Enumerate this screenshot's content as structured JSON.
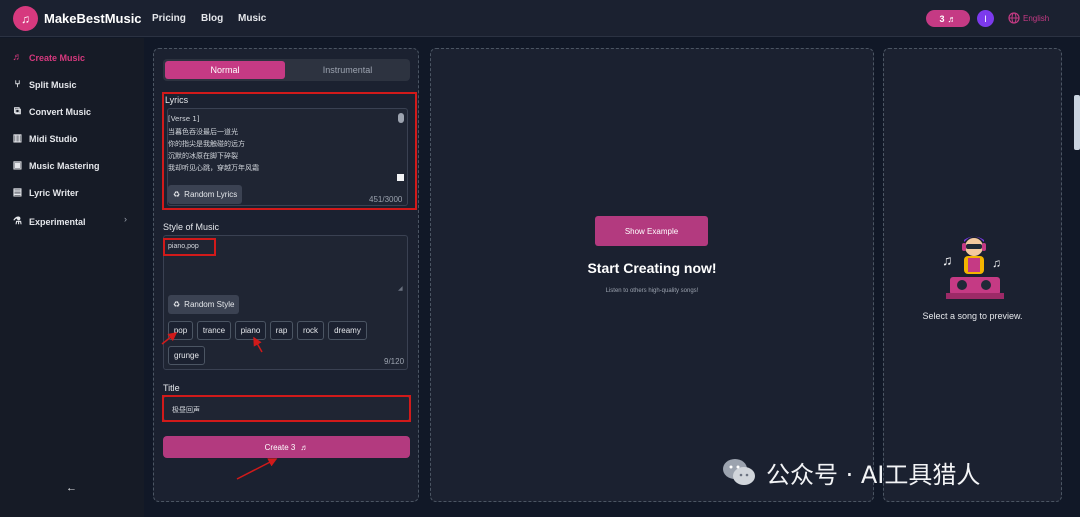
{
  "header": {
    "brand": "MakeBestMusic",
    "nav": [
      "Pricing",
      "Blog",
      "Music"
    ],
    "credits": "3",
    "avatar_initial": "I",
    "language": "English"
  },
  "sidebar": {
    "items": [
      {
        "label": "Create Music",
        "icon": "music-note-icon",
        "active": true
      },
      {
        "label": "Split Music",
        "icon": "split-icon"
      },
      {
        "label": "Convert Music",
        "icon": "convert-icon"
      },
      {
        "label": "Midi Studio",
        "icon": "midi-icon"
      },
      {
        "label": "Music Mastering",
        "icon": "mastering-icon"
      },
      {
        "label": "Lyric Writer",
        "icon": "document-icon"
      },
      {
        "label": "Experimental",
        "icon": "flask-icon"
      }
    ],
    "back": "←"
  },
  "form": {
    "mode_tabs": {
      "normal": "Normal",
      "instrumental": "Instrumental"
    },
    "lyrics_label": "Lyrics",
    "lyrics_lines": [
      "[Verse 1]",
      "当暮色吞没最后一道光",
      "你的指尖是我触碰的远方",
      "沉默的冰原在脚下碎裂",
      "我却听见心跳，穿越万年风霜"
    ],
    "random_lyrics": "Random Lyrics",
    "lyrics_count": "451/3000",
    "style_label": "Style of Music",
    "style_value": "piano,pop",
    "random_style": "Random Style",
    "style_tags": [
      "pop",
      "trance",
      "piano",
      "rap",
      "rock",
      "dreamy",
      "grunge"
    ],
    "style_count": "9/120",
    "title_label": "Title",
    "title_value": "极昼回声",
    "create_label": "Create  3"
  },
  "center": {
    "show_example": "Show Example",
    "heading": "Start Creating now!",
    "subtext": "Listen to others high-quality songs!"
  },
  "preview": {
    "text": "Select a song to preview."
  },
  "watermark": "公众号 · AI工具猎人",
  "colors": {
    "accent": "#c53a84",
    "annotation": "#d11a1a"
  }
}
